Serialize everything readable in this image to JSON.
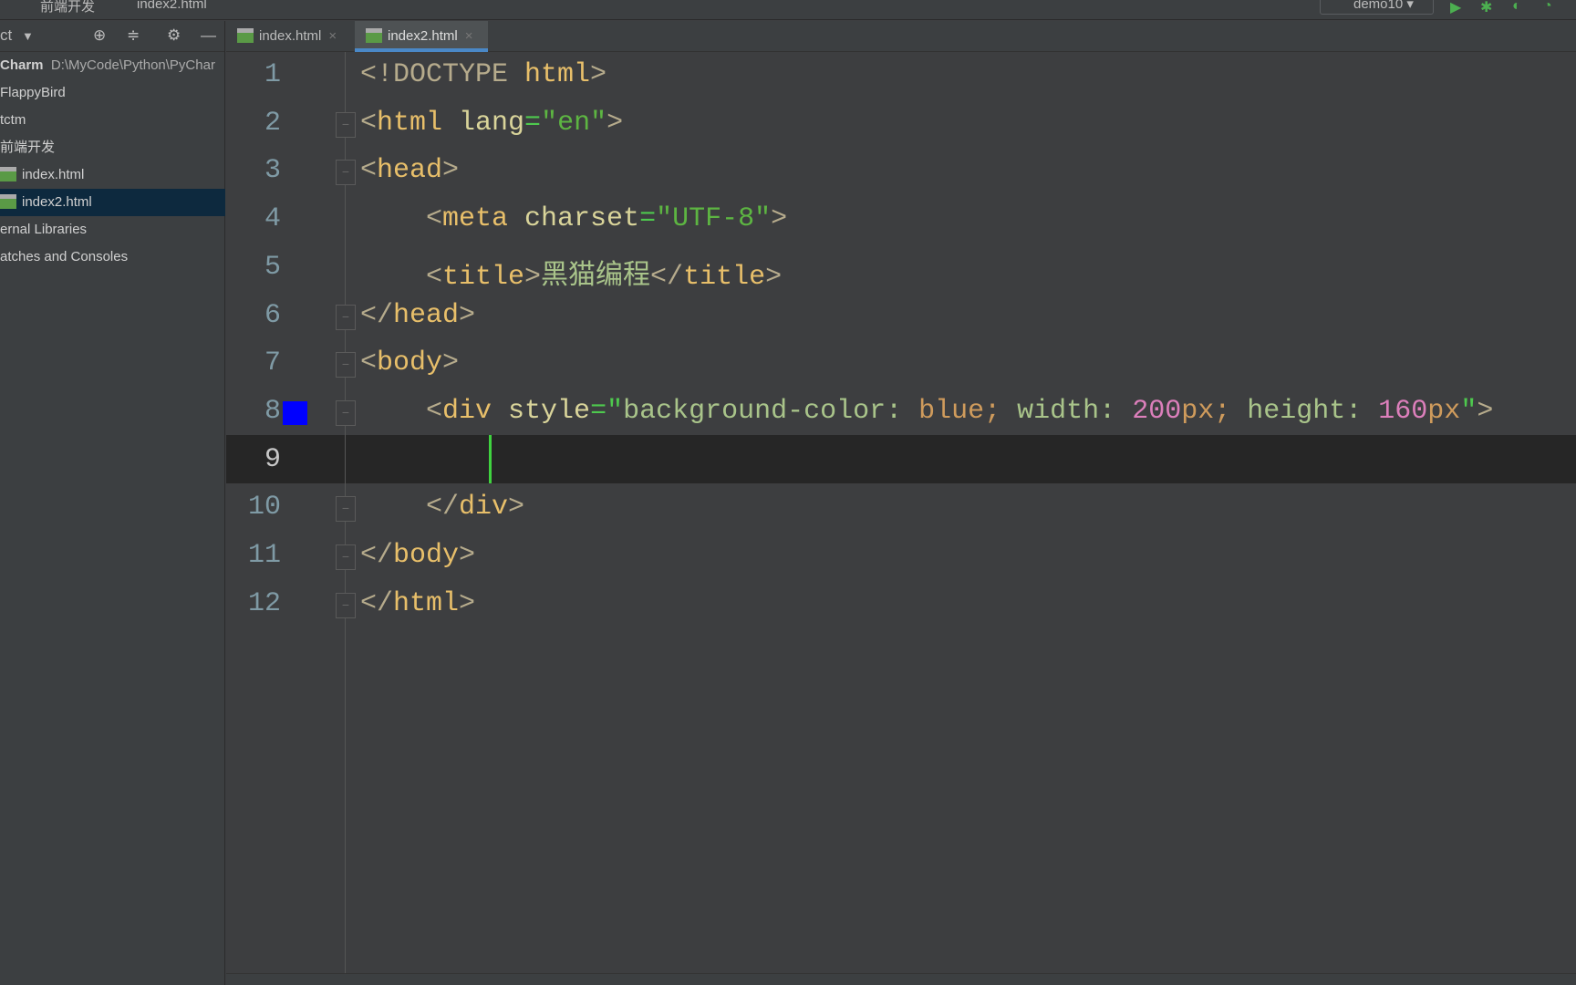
{
  "breadcrumb": {
    "folder": "前端开发",
    "file": "index2.html"
  },
  "run_config": {
    "name": "demo10"
  },
  "sidebar": {
    "title": "ct",
    "items": [
      {
        "label": "Charm",
        "path": "D:\\MyCode\\Python\\PyChar"
      },
      {
        "label": "FlappyBird"
      },
      {
        "label": "tctm"
      },
      {
        "label": "前端开发"
      },
      {
        "label": "index.html"
      },
      {
        "label": "index2.html"
      },
      {
        "label": "ernal Libraries"
      },
      {
        "label": "atches and Consoles"
      }
    ]
  },
  "tabs": [
    {
      "label": "index.html"
    },
    {
      "label": "index2.html",
      "active": true
    }
  ],
  "editor": {
    "line_numbers": [
      "1",
      "2",
      "3",
      "4",
      "5",
      "6",
      "7",
      "8",
      "9",
      "10",
      "11",
      "12"
    ],
    "current_line": 9,
    "color_swatch": "#0000ff",
    "lines": {
      "l1": {
        "a": "<!DOCTYPE ",
        "b": "html",
        "c": ">"
      },
      "l2": {
        "a": "<",
        "b": "html",
        "c": " lang",
        "d": "=",
        "e": "\"en\"",
        "f": ">"
      },
      "l3": {
        "a": "<",
        "b": "head",
        "c": ">"
      },
      "l4": {
        "a": "    <",
        "b": "meta",
        "c": " charset",
        "d": "=",
        "e": "\"UTF-8\"",
        "f": ">"
      },
      "l5": {
        "a": "    <",
        "b": "title",
        "c": ">",
        "d": "黑猫编程",
        "e": "</",
        "f": "title",
        "g": ">"
      },
      "l6": {
        "a": "</",
        "b": "head",
        "c": ">"
      },
      "l7": {
        "a": "<",
        "b": "body",
        "c": ">"
      },
      "l8": {
        "a": "    <",
        "b": "div",
        "c": " style",
        "d": "=\"",
        "e": "background-color: ",
        "f": "blue",
        "g": "; ",
        "h": "width: ",
        "i": "200",
        "j": "px",
        "k": "; ",
        "l": "height: ",
        "m": "160",
        "n": "px",
        "o": "\"",
        "p": ">"
      },
      "l10": {
        "a": "    </",
        "b": "div",
        "c": ">"
      },
      "l11": {
        "a": "</",
        "b": "body",
        "c": ">"
      },
      "l12": {
        "a": "</",
        "b": "html",
        "c": ">"
      }
    }
  }
}
